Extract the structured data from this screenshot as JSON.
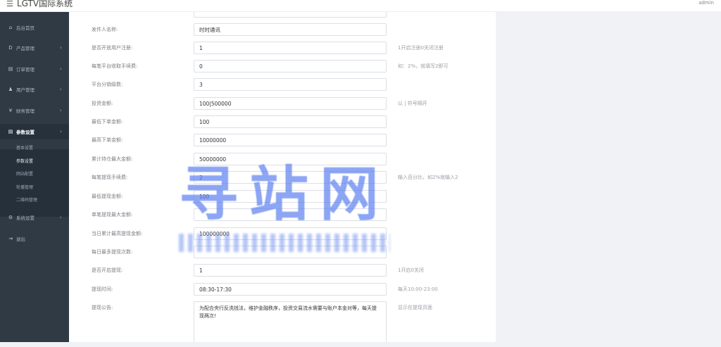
{
  "header": {
    "menu_icon": "hamburger-icon",
    "title": "LGTV国际系统",
    "user": "admin"
  },
  "sidebar": {
    "items": [
      {
        "icon": "dashboard-icon",
        "label": "后台首页",
        "arrow": ""
      },
      {
        "icon": "product-icon",
        "label": "产品管理",
        "arrow": "›"
      },
      {
        "icon": "order-icon",
        "label": "订单管理",
        "arrow": "›"
      },
      {
        "icon": "user-icon",
        "label": "用户管理",
        "arrow": "›"
      },
      {
        "icon": "finance-icon",
        "label": "财务管理",
        "arrow": "›"
      },
      {
        "icon": "settings-icon",
        "label": "参数设置",
        "arrow": "›"
      },
      {
        "icon": "system-icon",
        "label": "系统设置",
        "arrow": "›"
      },
      {
        "icon": "logout-icon",
        "label": "退出",
        "arrow": ""
      }
    ],
    "icon_glyphs": [
      "⌂",
      "D",
      "▤",
      "♟",
      "¥",
      "▤",
      "⚙",
      "⇥"
    ],
    "submenu": [
      "基本设置",
      "参数设置",
      "网站配置",
      "轮播管理",
      "二维码管理"
    ]
  },
  "form": {
    "rows": [
      {
        "label": "发件人名称:",
        "value": "时时通讯",
        "hint": ""
      },
      {
        "label": "是否开放用户注册:",
        "value": "1",
        "hint": "1开启注册0关闭注册"
      },
      {
        "label": "每笔平台收取手续费:",
        "value": "0",
        "hint": "如：2%，就填写2即可"
      },
      {
        "label": "平台分销级数:",
        "value": "3",
        "hint": ""
      },
      {
        "label": "投资金额:",
        "value": "100|500000",
        "hint": "以 | 符号隔开"
      },
      {
        "label": "最低下单金额:",
        "value": "100",
        "hint": ""
      },
      {
        "label": "最高下单金额:",
        "value": "10000000",
        "hint": ""
      },
      {
        "label": "累计持仓最大金额:",
        "value": "50000000",
        "hint": ""
      },
      {
        "label": "每笔提现手续费:",
        "value": "2",
        "hint": "输入百分比，如2%就输入2"
      },
      {
        "label": "最低提现金额:",
        "value": "100",
        "hint": ""
      },
      {
        "label": "单笔提现最大金额:",
        "value": "",
        "hint": ""
      },
      {
        "label": "当日累计最高提现金额:",
        "value": "100000000",
        "hint": ""
      },
      {
        "label": "每日最多提现次数:",
        "value": "",
        "hint": ""
      },
      {
        "label": "是否开启提现:",
        "value": "1",
        "hint": "1开启0关闭"
      },
      {
        "label": "提现时间:",
        "value": "08:30-17:30",
        "hint": "每天10:00-23:00"
      }
    ],
    "notice": {
      "label": "提现公告:",
      "value": "为配合央行反洗钱法，维护金融秩序，投资交易流水需要与账户本金对等，每天提现两次!",
      "hint": "显示在提现页面"
    }
  },
  "watermark": {
    "text": "寻站网"
  }
}
